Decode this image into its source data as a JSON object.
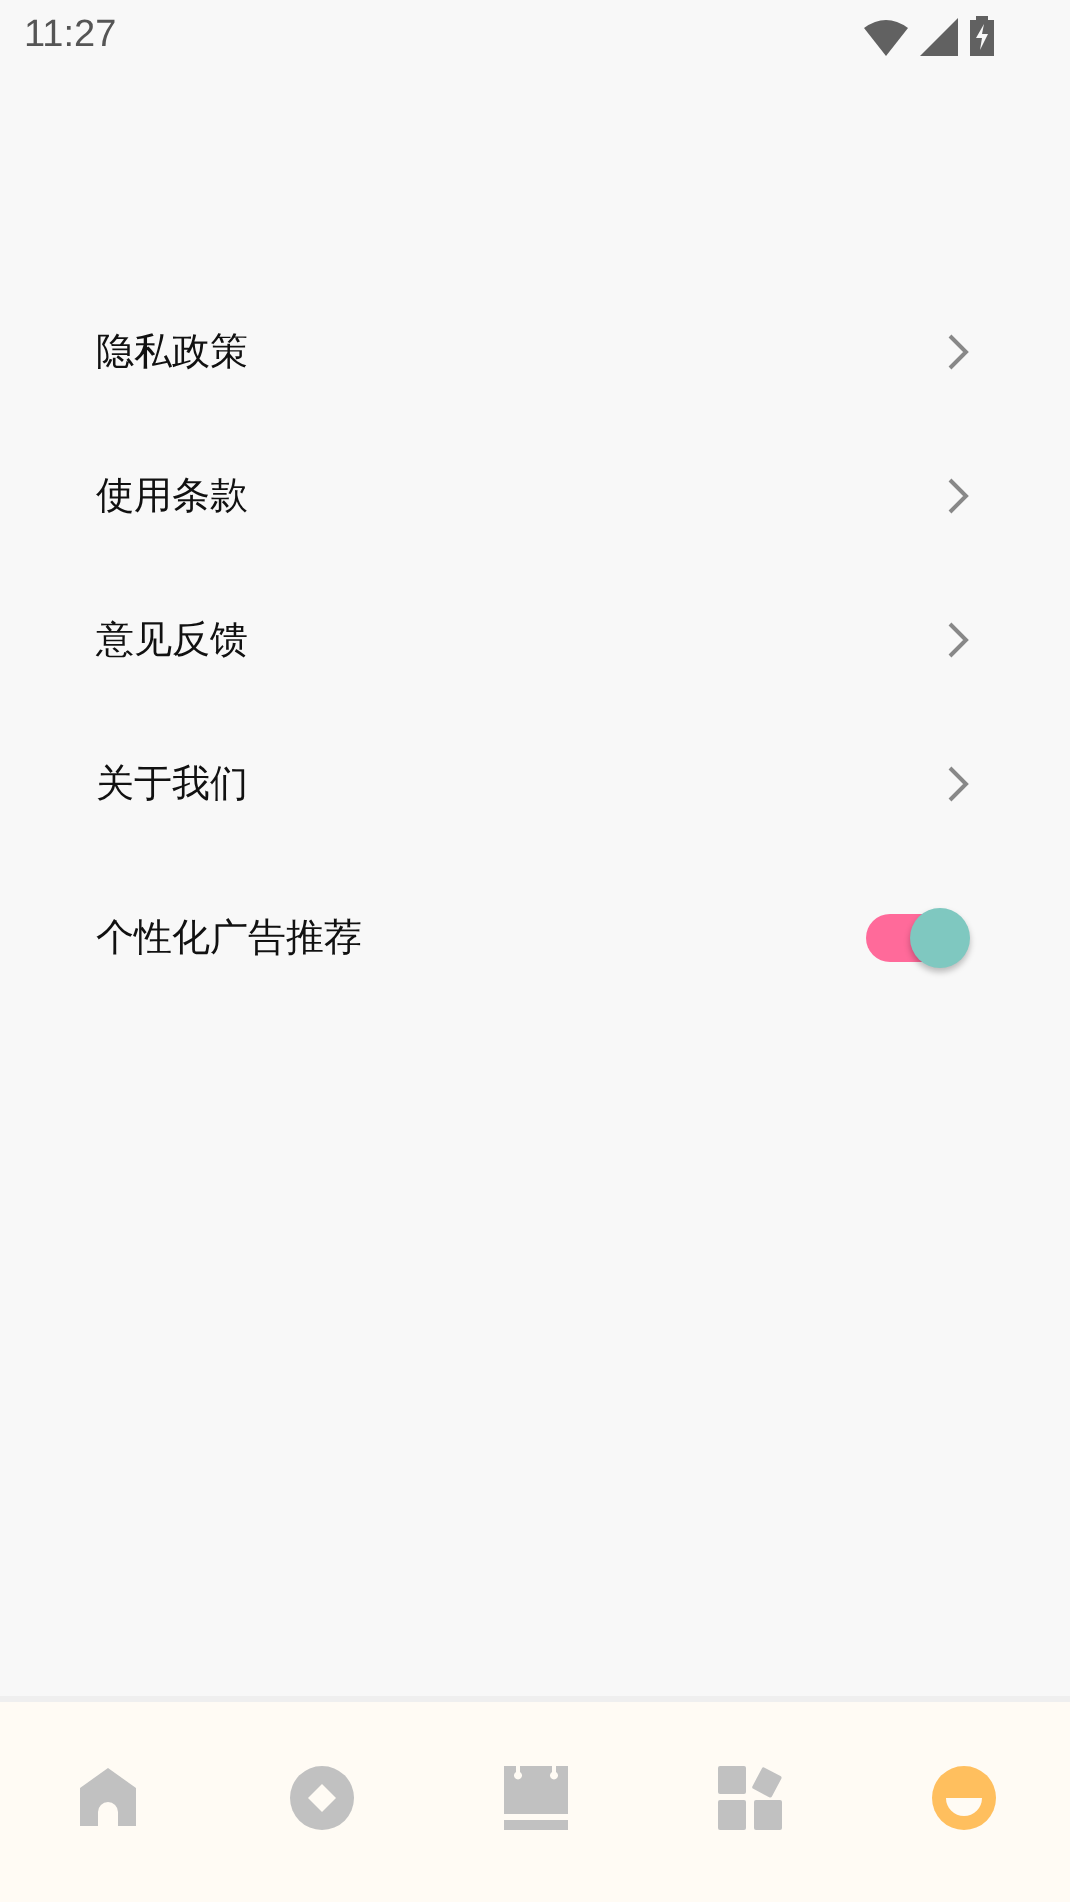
{
  "status_bar": {
    "time": "11:27"
  },
  "settings": [
    {
      "label": "隐私政策",
      "kind": "link"
    },
    {
      "label": "使用条款",
      "kind": "link"
    },
    {
      "label": "意见反馈",
      "kind": "link"
    },
    {
      "label": "关于我们",
      "kind": "link"
    },
    {
      "label": "个性化广告推荐",
      "kind": "toggle",
      "on": true
    }
  ],
  "bottom_nav": [
    {
      "kind": "home",
      "selected": false
    },
    {
      "kind": "diamond",
      "selected": false
    },
    {
      "kind": "calendar",
      "selected": false
    },
    {
      "kind": "apps",
      "selected": false
    },
    {
      "kind": "smile",
      "selected": true
    }
  ]
}
